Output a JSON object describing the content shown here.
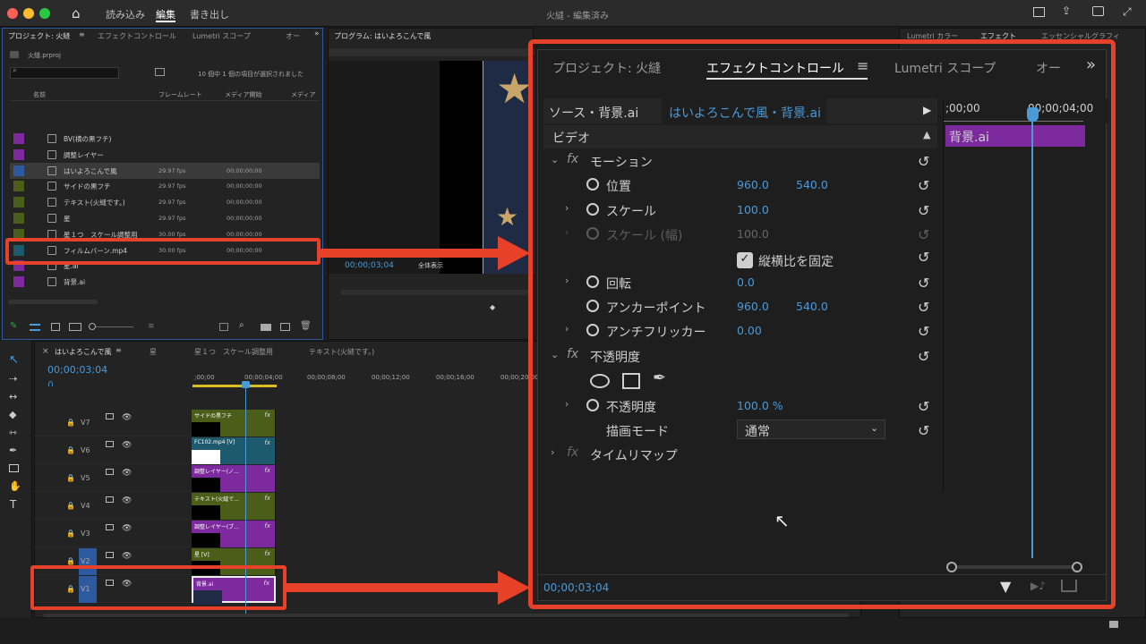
{
  "titlebar": {
    "title": "火縫 - 編集済み",
    "workspaces": [
      "読み込み",
      "編集",
      "書き出し"
    ],
    "active_workspace": "編集"
  },
  "project": {
    "tabs": [
      "プロジェクト: 火縫",
      "エフェクトコントロール",
      "Lumetri スコープ",
      "オー"
    ],
    "file": "火縫.prproj",
    "selection_info": "10 個中 1 個の項目が選択されました",
    "columns": [
      "名前",
      "フレームレート",
      "メディア開始",
      "メディア"
    ],
    "items": [
      {
        "name": "BV(横の黒フチ)",
        "fps": "",
        "start": "",
        "color": "#7d2a9e"
      },
      {
        "name": "調整レイヤー",
        "fps": "",
        "start": "",
        "color": "#7d2a9e"
      },
      {
        "name": "はいよろこんで風",
        "fps": "29.97 fps",
        "start": "00;00;00;00",
        "color": "#2d5a9e"
      },
      {
        "name": "サイドの黒フチ",
        "fps": "29.97 fps",
        "start": "00;00;00;00",
        "color": "#4a5e1a"
      },
      {
        "name": "テキスト(火縫です。)",
        "fps": "29.97 fps",
        "start": "00;00;00;00",
        "color": "#4a5e1a"
      },
      {
        "name": "星",
        "fps": "29.97 fps",
        "start": "00;00;00;00",
        "color": "#4a5e1a"
      },
      {
        "name": "星１つ　スケール調整用",
        "fps": "30.00 fps",
        "start": "00;00;00;00",
        "color": "#4a5e1a"
      },
      {
        "name": "フィルムバーン.mp4",
        "fps": "30.00 fps",
        "start": "00;00;00;00",
        "color": "#1e5a6e"
      },
      {
        "name": "星.ai",
        "fps": "",
        "start": "",
        "color": "#7d2a9e"
      },
      {
        "name": "背景.ai",
        "fps": "",
        "start": "",
        "color": "#7d2a9e"
      }
    ]
  },
  "program": {
    "tab": "プログラム: はいよろこんで風",
    "timecode": "00;00;03;04",
    "fit": "全体表示"
  },
  "right_tabs": [
    "Lumetri カラー",
    "エフェクト",
    "エッセンシャルグラフィ"
  ],
  "timeline": {
    "tabs": [
      "はいよろこんで風",
      "星",
      "星１つ　スケール調整用",
      "テキスト(火縫です。)"
    ],
    "timecode": "00;00;03;04",
    "ruler": [
      ";00;00",
      "00;00;04;00",
      "00;00;08;00",
      "00;00;12;00",
      "00;00;16;00",
      "00;00;20;00"
    ],
    "tracks": [
      {
        "label": "V7",
        "clip": "サイドの黒フチ",
        "color": "#4a5e1a"
      },
      {
        "label": "V6",
        "clip": "FC102.mp4 [V]",
        "color": "#1e5a6e"
      },
      {
        "label": "V5",
        "clip": "調整レイヤー(ノ...",
        "color": "#7d2a9e"
      },
      {
        "label": "V4",
        "clip": "テキスト(火縫で...",
        "color": "#4a5e1a"
      },
      {
        "label": "V3",
        "clip": "調整レイヤー(ブ...",
        "color": "#7d2a9e"
      },
      {
        "label": "V2",
        "clip": "星 [V]",
        "color": "#4a5e1a"
      },
      {
        "label": "V1",
        "clip": "背景.ai",
        "color": "#7d2a9e"
      }
    ]
  },
  "effect_controls": {
    "tabs": [
      "プロジェクト: 火縫",
      "エフェクトコントロール",
      "Lumetri スコープ",
      "オー"
    ],
    "source": "ソース・背景.ai",
    "sequence": "はいよろこんで風・背景.ai",
    "section": "ビデオ",
    "ruler_start": ";00;00",
    "ruler_end": "00;00;04;00",
    "clip_name": "背景.ai",
    "motion": "モーション",
    "props": [
      {
        "label": "位置",
        "v1": "960.0",
        "v2": "540.0",
        "expand": false
      },
      {
        "label": "スケール",
        "v1": "100.0",
        "v2": "",
        "expand": true
      },
      {
        "label": "スケール (幅)",
        "v1": "100.0",
        "v2": "",
        "expand": true,
        "disabled": true
      },
      {
        "label": "回転",
        "v1": "0.0",
        "v2": "",
        "expand": true
      },
      {
        "label": "アンカーポイント",
        "v1": "960.0",
        "v2": "540.0",
        "expand": false
      },
      {
        "label": "アンチフリッカー",
        "v1": "0.00",
        "v2": "",
        "expand": true
      }
    ],
    "uniform_scale": "縦横比を固定",
    "opacity_section": "不透明度",
    "opacity_label": "不透明度",
    "opacity_value": "100.0 %",
    "blend_label": "描画モード",
    "blend_value": "通常",
    "time_remap": "タイムリマップ",
    "timecode": "00;00;03;04"
  }
}
